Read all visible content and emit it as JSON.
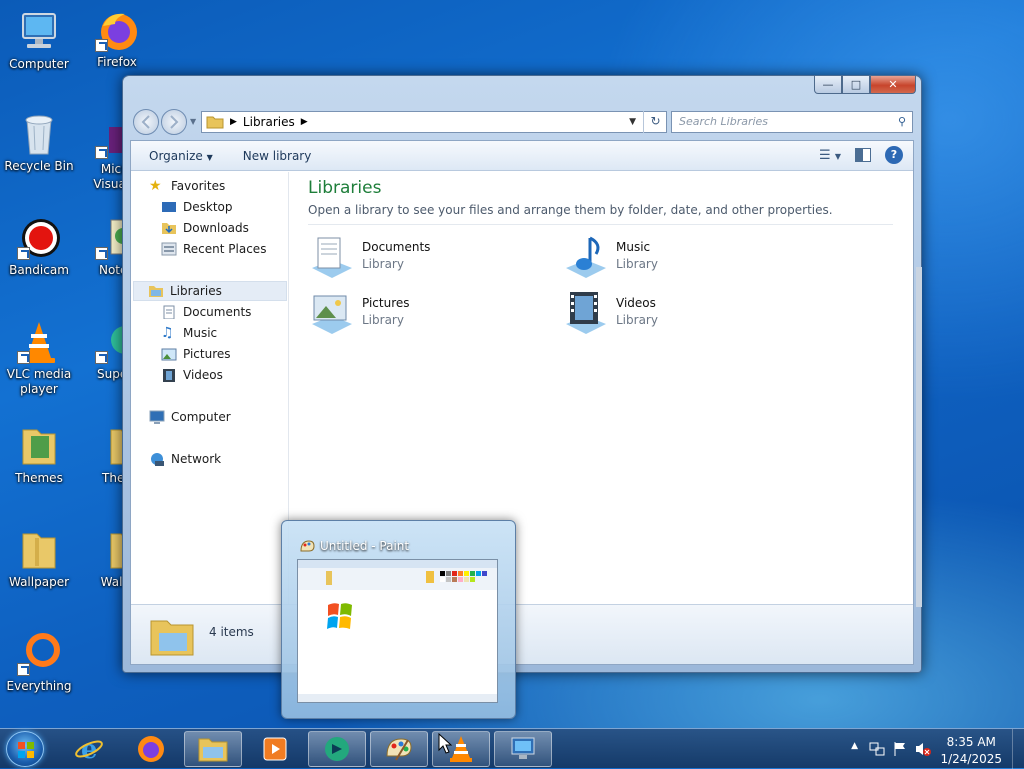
{
  "desktop": {
    "icons": [
      {
        "label": "Computer"
      },
      {
        "label": "Firefox"
      },
      {
        "label": "Recycle Bin"
      },
      {
        "label": "Micro\nVisual S"
      },
      {
        "label": "Bandicam"
      },
      {
        "label": "Notep"
      },
      {
        "label": "VLC media\nplayer"
      },
      {
        "label": "Superr"
      },
      {
        "label": "Themes"
      },
      {
        "label": "Then"
      },
      {
        "label": "Wallpaper"
      },
      {
        "label": "Wallp"
      },
      {
        "label": "Everything"
      }
    ]
  },
  "explorer": {
    "address": "Libraries",
    "search_placeholder": "Search Libraries",
    "toolbar": {
      "organize": "Organize",
      "new_library": "New library"
    },
    "nav": {
      "favorites": "Favorites",
      "desktop": "Desktop",
      "downloads": "Downloads",
      "recent_places": "Recent Places",
      "libraries": "Libraries",
      "documents": "Documents",
      "music": "Music",
      "pictures": "Pictures",
      "videos": "Videos",
      "computer": "Computer",
      "network": "Network"
    },
    "content": {
      "title": "Libraries",
      "subtitle": "Open a library to see your files and arrange them by folder, date, and other properties.",
      "libraries": [
        {
          "name": "Documents",
          "type": "Library"
        },
        {
          "name": "Music",
          "type": "Library"
        },
        {
          "name": "Pictures",
          "type": "Library"
        },
        {
          "name": "Videos",
          "type": "Library"
        }
      ]
    },
    "status": {
      "count": "4 items"
    }
  },
  "preview": {
    "title": "Untitled - Paint"
  },
  "taskbar": {
    "clock_time": "8:35 AM",
    "clock_date": "1/24/2025"
  },
  "colors": {
    "accent": "#1e7e3a",
    "selection": "#e4ecf6",
    "taskbar": "#1c4a82"
  }
}
